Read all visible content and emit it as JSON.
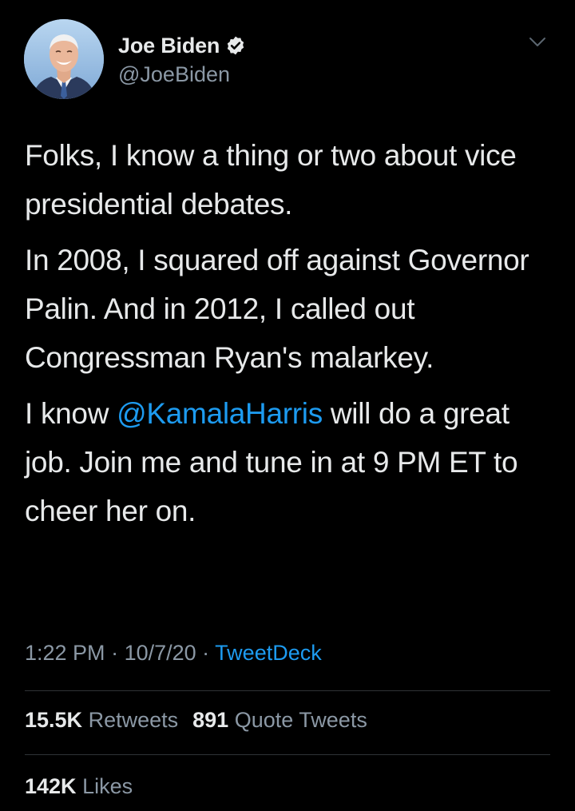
{
  "tweet": {
    "author": {
      "display_name": "Joe Biden",
      "handle": "@JoeBiden",
      "verified_icon": "verified-badge-icon",
      "avatar": "profile-photo"
    },
    "menu_icon": "chevron-down-icon",
    "text": {
      "p1": "Folks, I know a thing or two about vice presidential debates.",
      "p2": "In 2008, I squared off against Governor Palin. And in 2012, I called out Congressman Ryan's malarkey.",
      "p3_before": "I know ",
      "p3_mention": "@KamalaHarris",
      "p3_after": " will do a great job. Join me and tune in at 9 PM ET to cheer her on."
    },
    "meta": {
      "time": "1:22 PM",
      "sep1": " · ",
      "date": "10/7/20",
      "sep2": " · ",
      "source": "TweetDeck"
    },
    "stats": {
      "retweets_count": "15.5K",
      "retweets_label": "Retweets",
      "quotes_count": "891",
      "quotes_label": "Quote Tweets",
      "likes_count": "142K",
      "likes_label": "Likes"
    }
  },
  "colors": {
    "background": "#000000",
    "text": "#e7e9ea",
    "secondary": "#8b98a5",
    "link": "#1d9bf0",
    "divider": "#2f3336"
  }
}
